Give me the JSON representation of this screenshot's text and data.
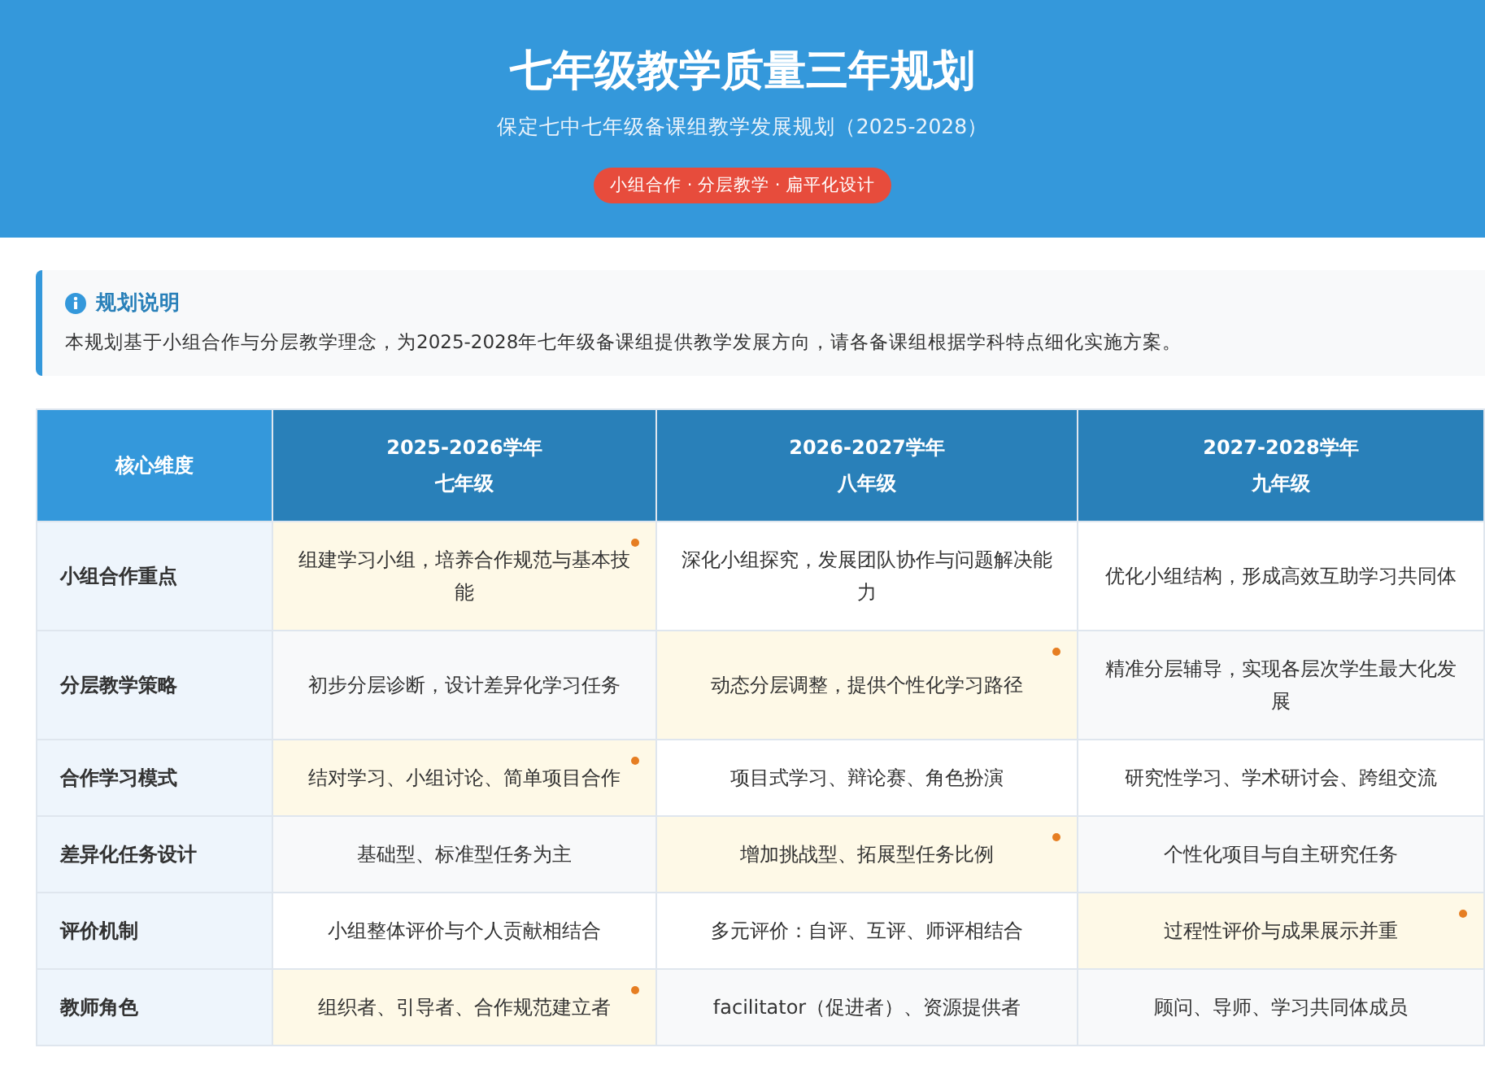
{
  "header": {
    "title": "七年级教学质量三年规划",
    "subtitle": "保定七中七年级备课组教学发展规划（2025-2028）",
    "tag": "小组合作 · 分层教学 · 扁平化设计"
  },
  "note": {
    "title": "规划说明",
    "text": "本规划基于小组合作与分层教学理念，为2025-2028年七年级备课组提供教学发展方向，请各备课组根据学科特点细化实施方案。"
  },
  "table": {
    "columns": [
      {
        "lines": [
          "核心维度"
        ]
      },
      {
        "lines": [
          "2025-2026学年",
          "七年级"
        ]
      },
      {
        "lines": [
          "2026-2027学年",
          "八年级"
        ]
      },
      {
        "lines": [
          "2027-2028学年",
          "九年级"
        ]
      }
    ],
    "rows": [
      {
        "cells": [
          {
            "text": "小组合作重点",
            "highlighted": false
          },
          {
            "text": "组建学习小组，培养合作规范与基本技能",
            "highlighted": true
          },
          {
            "text": "深化小组探究，发展团队协作与问题解决能力",
            "highlighted": false
          },
          {
            "text": "优化小组结构，形成高效互助学习共同体",
            "highlighted": false
          }
        ]
      },
      {
        "cells": [
          {
            "text": "分层教学策略",
            "highlighted": false
          },
          {
            "text": "初步分层诊断，设计差异化学习任务",
            "highlighted": false
          },
          {
            "text": "动态分层调整，提供个性化学习路径",
            "highlighted": true
          },
          {
            "text": "精准分层辅导，实现各层次学生最大化发展",
            "highlighted": false
          }
        ]
      },
      {
        "cells": [
          {
            "text": "合作学习模式",
            "highlighted": false
          },
          {
            "text": "结对学习、小组讨论、简单项目合作",
            "highlighted": true
          },
          {
            "text": "项目式学习、辩论赛、角色扮演",
            "highlighted": false
          },
          {
            "text": "研究性学习、学术研讨会、跨组交流",
            "highlighted": false
          }
        ]
      },
      {
        "cells": [
          {
            "text": "差异化任务设计",
            "highlighted": false
          },
          {
            "text": "基础型、标准型任务为主",
            "highlighted": false
          },
          {
            "text": "增加挑战型、拓展型任务比例",
            "highlighted": true
          },
          {
            "text": "个性化项目与自主研究任务",
            "highlighted": false
          }
        ]
      },
      {
        "cells": [
          {
            "text": "评价机制",
            "highlighted": false
          },
          {
            "text": "小组整体评价与个人贡献相结合",
            "highlighted": false
          },
          {
            "text": "多元评价：自评、互评、师评相结合",
            "highlighted": false
          },
          {
            "text": "过程性评价与成果展示并重",
            "highlighted": true
          }
        ]
      },
      {
        "cells": [
          {
            "text": "教师角色",
            "highlighted": false
          },
          {
            "text": "组织者、引导者、合作规范建立者",
            "highlighted": true
          },
          {
            "text": "facilitator（促进者）、资源提供者",
            "highlighted": false
          },
          {
            "text": "顾问、导师、学习共同体成员",
            "highlighted": false
          }
        ]
      }
    ]
  }
}
